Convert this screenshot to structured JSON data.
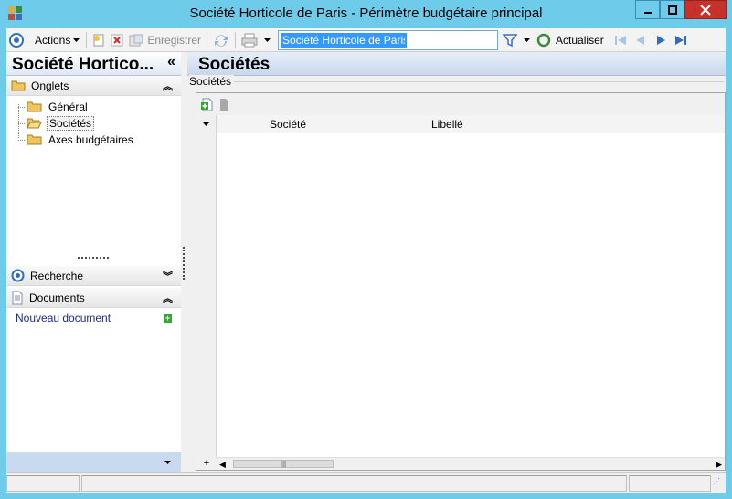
{
  "window": {
    "title": "Société Horticole de Paris -  Périmètre budgétaire principal"
  },
  "toolbar": {
    "actions_label": "Actions",
    "save_label": "Enregistrer",
    "search_value": "Société Horticole de Paris",
    "refresh_label": "Actualiser"
  },
  "left_panel": {
    "title": "Société Hortico...",
    "sections": {
      "tabs": "Onglets",
      "search": "Recherche",
      "documents": "Documents"
    },
    "tree_items": [
      {
        "label": "Général"
      },
      {
        "label": "Sociétés"
      },
      {
        "label": "Axes budgétaires"
      }
    ],
    "new_document_label": "Nouveau document"
  },
  "main": {
    "title": "Sociétés",
    "group_title": "Sociétés",
    "grid_columns": [
      "Société",
      "Libellé"
    ]
  },
  "colors": {
    "window_frame": "#6fcbea",
    "close_button": "#c7312a",
    "selection": "#3399ff",
    "link": "#1f2b8c"
  }
}
